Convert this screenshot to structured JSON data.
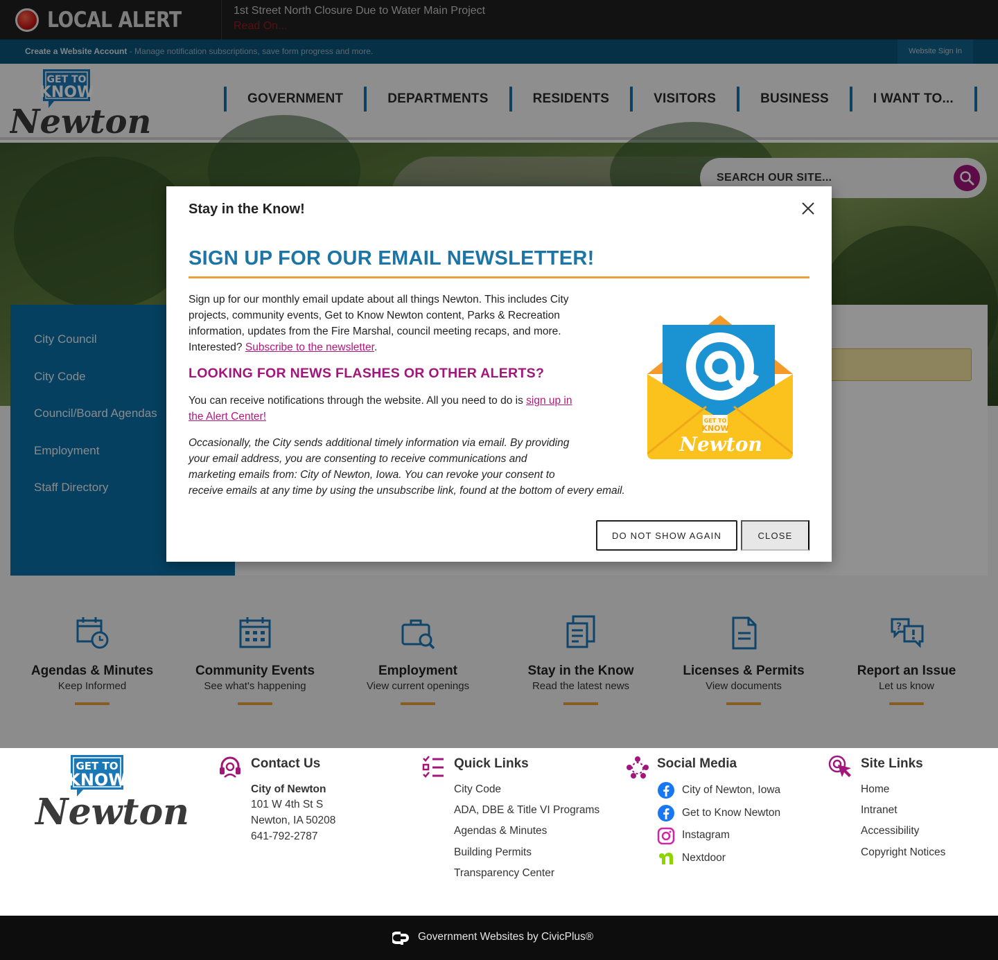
{
  "alert": {
    "label": "LOCAL ALERT",
    "title": "1st Street North Closure Due to Water Main Project",
    "read_more": "Read On..."
  },
  "account": {
    "create_label": "Create a Website Account",
    "create_desc": " - Manage notification subscriptions, save form progress and more.",
    "sign_in": "Website Sign In"
  },
  "logo": {
    "line1": "GET TO",
    "line2": "KNOW",
    "name": "Newton"
  },
  "nav": [
    "GOVERNMENT",
    "DEPARTMENTS",
    "RESIDENTS",
    "VISITORS",
    "BUSINESS",
    "I WANT TO..."
  ],
  "search": {
    "placeholder": "SEARCH OUR SITE..."
  },
  "sidebar": [
    "City Council",
    "City Code",
    "Council/Board Agendas",
    "Employment",
    "Staff Directory"
  ],
  "modal": {
    "header": "Stay in the Know!",
    "title": "SIGN UP FOR OUR EMAIL NEWSLETTER!",
    "p1_a": "Sign up for our monthly email update about all things Newton. This includes City",
    "p1_b": "projects, community events, Get to Know Newton content, Parks & Recreation",
    "p1_c": "information, updates from the Fire Marshal, council meeting recaps, and more.",
    "p1_d": "Interested? ",
    "p1_link": "Subscribe to the newsletter",
    "p1_end": ".",
    "subtitle": "LOOKING FOR NEWS FLASHES OR OTHER ALERTS?",
    "p2_a": "You can receive notifications through the website. All you need to do is ",
    "p2_link1": "sign up in",
    "p2_link2": "the Alert Center!",
    "p3_a": "Occasionally, the City sends additional timely information via email. By providing",
    "p3_b": "your email address, you are consenting to receive communications and",
    "p3_c": "marketing emails from: City of Newton, Iowa. You can revoke your consent to",
    "p3_d": "receive emails at any time by using the unsubscribe link, found at the bottom of every email.",
    "btn_dont": "DO NOT SHOW AGAIN",
    "btn_close": "CLOSE",
    "envelope_line1": "GET TO",
    "envelope_line2": "KNOW",
    "envelope_name": "Newton"
  },
  "quick_links": [
    {
      "title": "Agendas & Minutes",
      "sub": "Keep Informed",
      "icon": "calendar-clock-icon"
    },
    {
      "title": "Community Events",
      "sub": "See what's happening",
      "icon": "calendar-grid-icon"
    },
    {
      "title": "Employment",
      "sub": "View current openings",
      "icon": "briefcase-search-icon"
    },
    {
      "title": "Stay in the Know",
      "sub": "Read the latest news",
      "icon": "newspaper-icon"
    },
    {
      "title": "Licenses & Permits",
      "sub": "View documents",
      "icon": "document-icon"
    },
    {
      "title": "Report an Issue",
      "sub": "Let us know",
      "icon": "speech-alert-icon"
    }
  ],
  "footer": {
    "contact": {
      "title": "Contact Us",
      "org": "City of Newton",
      "addr1": "101 W 4th St S",
      "addr2": "Newton, IA 50208",
      "phone": "641-792-2787"
    },
    "quick": {
      "title": "Quick Links",
      "items": [
        "City Code",
        "ADA, DBE & Title VI Programs",
        "Agendas & Minutes",
        "Building Permits",
        "Transparency Center"
      ]
    },
    "social": {
      "title": "Social Media",
      "items": [
        "City of Newton, Iowa",
        "Get to Know Newton",
        "Instagram",
        "Nextdoor"
      ]
    },
    "site": {
      "title": "Site Links",
      "items": [
        "Home",
        "Intranet",
        "Accessibility",
        "Copyright Notices"
      ]
    }
  },
  "bottom": {
    "text": "Government Websites by CivicPlus®"
  },
  "colors": {
    "accent_blue": "#1d75a6",
    "magenta": "#a2167b",
    "orange": "#e8a13a",
    "sidebar_blue": "#0a6fa5"
  }
}
